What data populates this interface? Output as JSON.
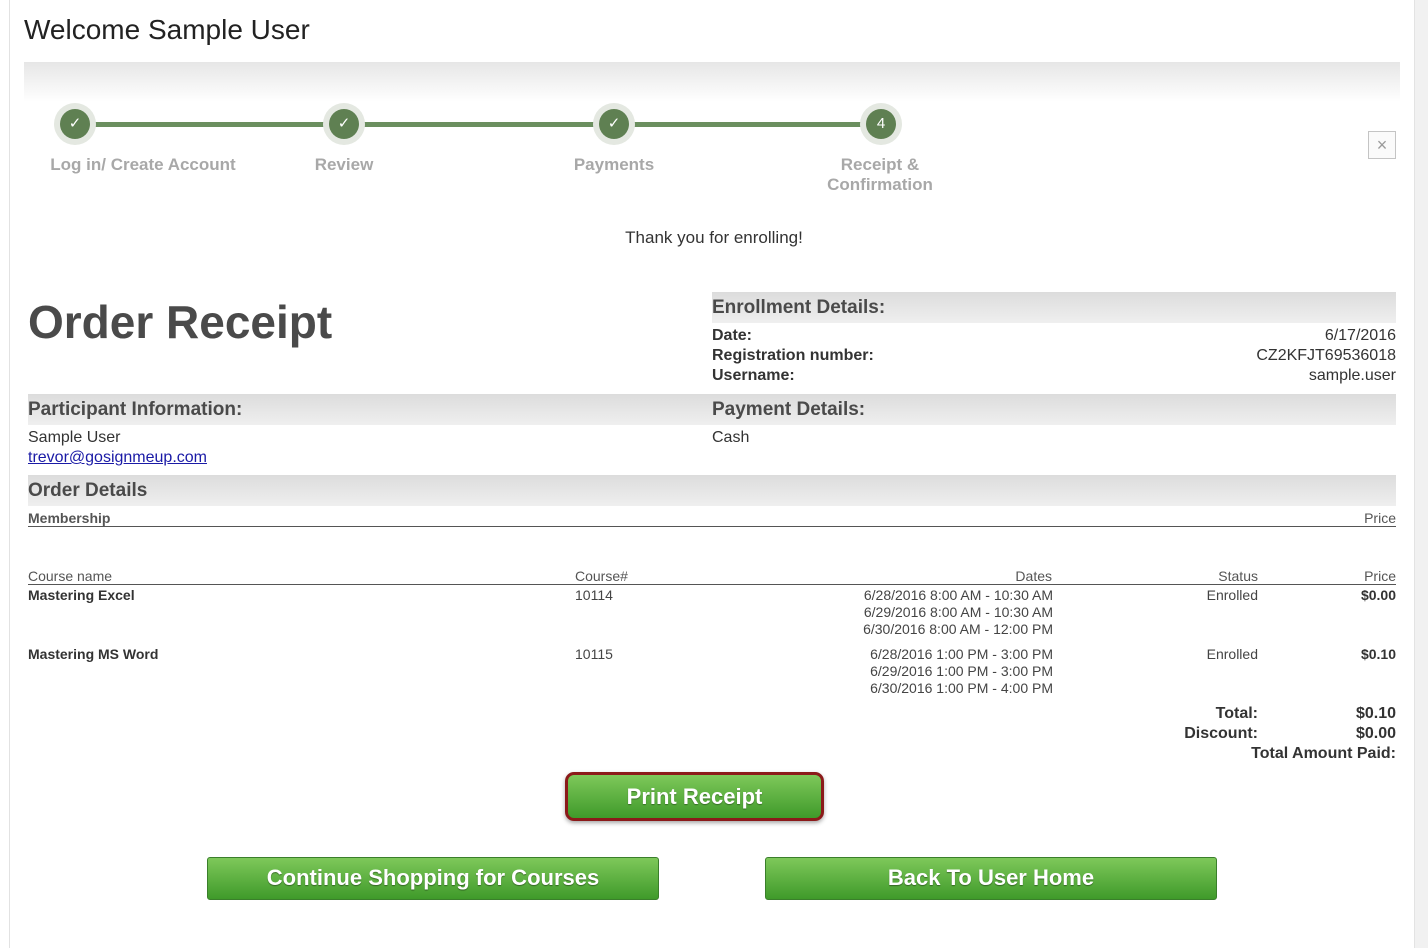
{
  "header": {
    "welcome": "Welcome Sample User"
  },
  "steps": [
    {
      "label": "Log in/ Create Account",
      "marker": "✓",
      "state": "complete"
    },
    {
      "label": "Review",
      "marker": "✓",
      "state": "complete"
    },
    {
      "label": "Payments",
      "marker": "✓",
      "state": "complete"
    },
    {
      "label": "Receipt & Confirmation",
      "marker": "4",
      "state": "current"
    }
  ],
  "close_icon": "×",
  "thanks": "Thank you for enrolling!",
  "receipt": {
    "title": "Order Receipt",
    "enrollment": {
      "heading": "Enrollment Details:",
      "date_label": "Date:",
      "date": "6/17/2016",
      "reg_label": "Registration number:",
      "reg": "CZ2KFJT69536018",
      "user_label": "Username:",
      "user": "sample.user"
    },
    "participant": {
      "heading": "Participant Information:",
      "name": "Sample User",
      "email": "trevor@gosignmeup.com"
    },
    "payment": {
      "heading": "Payment Details:",
      "method": "Cash"
    },
    "order": {
      "heading": "Order Details",
      "membership_header": {
        "membership": "Membership",
        "price": "Price"
      },
      "course_headers": {
        "name": "Course name",
        "number": "Course#",
        "dates": "Dates",
        "status": "Status",
        "price": "Price"
      },
      "rows": [
        {
          "name": "Mastering Excel",
          "number": "10114",
          "dates": [
            "6/28/2016 8:00 AM - 10:30 AM",
            "6/29/2016 8:00 AM - 10:30 AM",
            "6/30/2016 8:00 AM - 12:00 PM"
          ],
          "status": "Enrolled",
          "price": "$0.00"
        },
        {
          "name": "Mastering MS Word",
          "number": "10115",
          "dates": [
            "6/28/2016 1:00 PM - 3:00 PM",
            "6/29/2016 1:00 PM - 3:00 PM",
            "6/30/2016 1:00 PM - 4:00 PM"
          ],
          "status": "Enrolled",
          "price": "$0.10"
        }
      ],
      "totals": {
        "total_label": "Total:",
        "total": "$0.10",
        "discount_label": "Discount:",
        "discount": "$0.00",
        "paid_label": "Total Amount Paid:"
      }
    }
  },
  "buttons": {
    "print": "Print Receipt",
    "continue": "Continue Shopping for Courses",
    "home": "Back To User Home"
  },
  "colors": {
    "accent_green": "#4ea634",
    "step_green": "#5f8052",
    "highlight_border": "#8b1a1a"
  }
}
